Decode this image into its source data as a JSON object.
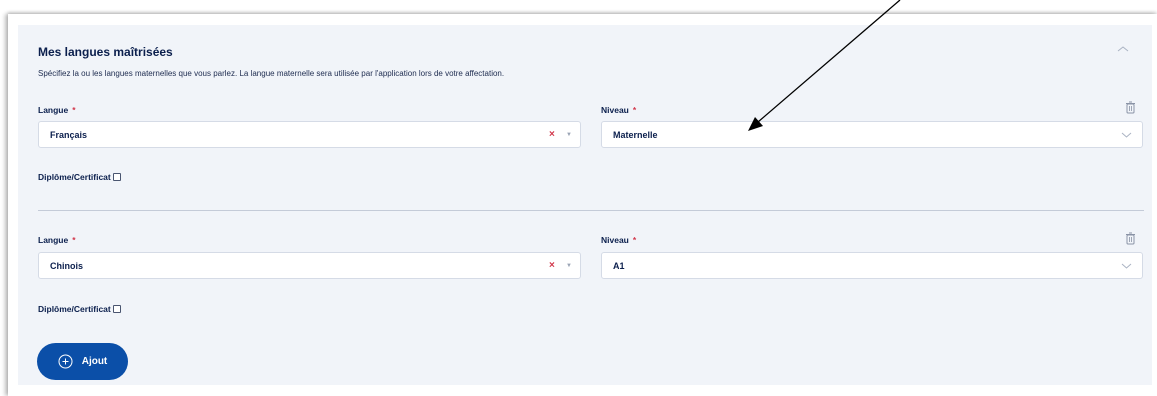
{
  "section": {
    "title": "Mes langues maîtrisées",
    "description": "Spécifiez la ou les langues maternelles que vous parlez. La langue maternelle sera utilisée par l'application lors de votre affectation."
  },
  "languages": [
    {
      "language_label": "Langue",
      "language_value": "Français",
      "level_label": "Niveau",
      "level_value": "Maternelle",
      "required_marker": "*",
      "clear_glyph": "×",
      "diploma_label": "Diplôme/Certificat",
      "diploma_checked": false
    },
    {
      "language_label": "Langue",
      "language_value": "Chinois",
      "level_label": "Niveau",
      "level_value": "A1",
      "required_marker": "*",
      "clear_glyph": "×",
      "diploma_label": "Diplôme/Certificat",
      "diploma_checked": false
    }
  ],
  "add_button": {
    "label": "Ajout"
  },
  "icons": {
    "collapse": "chevron-up-icon",
    "dropdown": "chevron-down-icon",
    "delete": "trash-icon",
    "clear": "clear-icon",
    "add": "plus-circle-icon",
    "annotation": "arrow-annotation"
  },
  "colors": {
    "card_background": "#f1f4f9",
    "primary": "#0b4fa8",
    "text_dark": "#0b1f4d",
    "required": "#d2374b"
  }
}
